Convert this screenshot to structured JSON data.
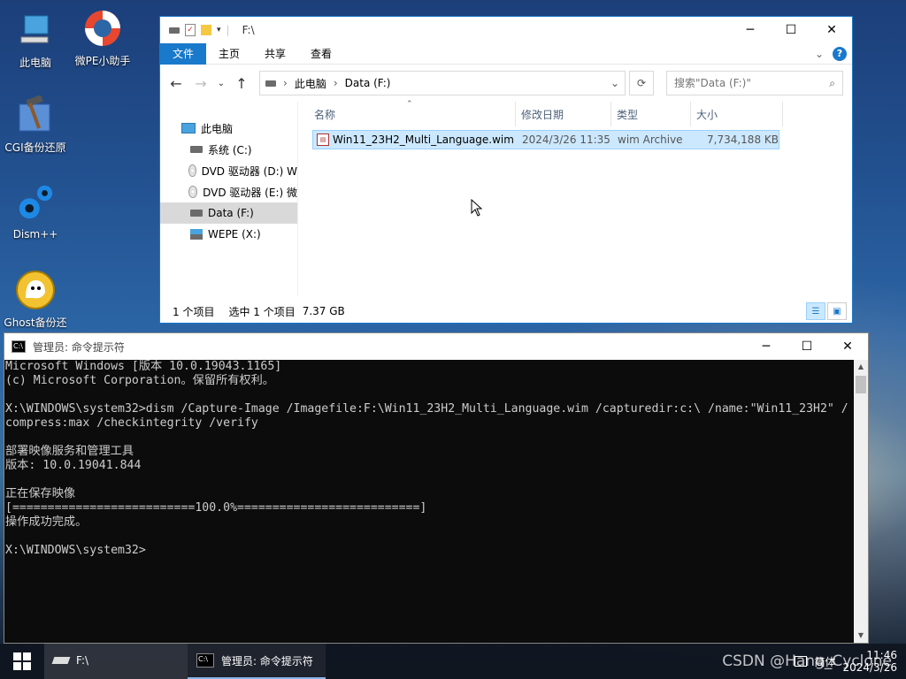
{
  "desktop": {
    "icons": [
      {
        "label": "此电脑",
        "icon": "computer-icon"
      },
      {
        "label": "微PE小助手",
        "icon": "lifebuoy-icon"
      },
      {
        "label": "CGI备份还原",
        "icon": "hammer-icon"
      },
      {
        "label": "Dism++",
        "icon": "gears-icon"
      },
      {
        "label": "Ghost备份还原",
        "icon": "ghost-icon"
      }
    ]
  },
  "explorer": {
    "title": "F:\\",
    "ribbon_tabs": [
      "文件",
      "主页",
      "共享",
      "查看"
    ],
    "address": {
      "crumbs": [
        "此电脑",
        "Data (F:)"
      ]
    },
    "search_placeholder": "搜索\"Data (F:)\"",
    "nav_items": [
      {
        "label": "此电脑",
        "icon": "pc-icon"
      },
      {
        "label": "系统 (C:)",
        "icon": "drive-icon"
      },
      {
        "label": "DVD 驱动器 (D:) W",
        "icon": "dvd-icon"
      },
      {
        "label": "DVD 驱动器 (E:) 微",
        "icon": "dvd-icon"
      },
      {
        "label": "Data (F:)",
        "icon": "drive-icon",
        "selected": true
      },
      {
        "label": "WEPE (X:)",
        "icon": "network-drive-icon"
      }
    ],
    "columns": [
      "名称",
      "修改日期",
      "类型",
      "大小"
    ],
    "files": [
      {
        "name": "Win11_23H2_Multi_Language.wim",
        "modified": "2024/3/26 11:35",
        "type": "wim Archive",
        "size": "7,734,188 KB"
      }
    ],
    "status": {
      "count": "1 个项目",
      "selected": "选中 1 个项目",
      "size": "7.37 GB"
    }
  },
  "cmd": {
    "title": "管理员: 命令提示符",
    "lines": [
      "Microsoft Windows [版本 10.0.19043.1165]",
      "(c) Microsoft Corporation。保留所有权利。",
      "",
      "X:\\WINDOWS\\system32>dism /Capture-Image /Imagefile:F:\\Win11_23H2_Multi_Language.wim /capturedir:c:\\ /name:\"Win11_23H2\" /",
      "compress:max /checkintegrity /verify",
      "",
      "部署映像服务和管理工具",
      "版本: 10.0.19041.844",
      "",
      "正在保存映像",
      "[==========================100.0%==========================]",
      "操作成功完成。",
      "",
      "X:\\WINDOWS\\system32>"
    ]
  },
  "taskbar": {
    "items": [
      {
        "label": "F:\\",
        "icon": "drive-icon"
      },
      {
        "label": "管理员: 命令提示符",
        "icon": "cmd-icon"
      }
    ],
    "tray_label": "简体",
    "time": "11:46",
    "date": "2024/3/26"
  },
  "watermark": "CSDN @Hang_Cyclone"
}
